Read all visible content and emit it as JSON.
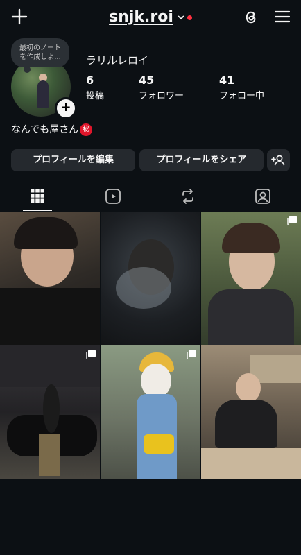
{
  "header": {
    "username": "snjk.roi"
  },
  "note": {
    "text_line1": "最初のノート",
    "text_line2": "を作成しよ..."
  },
  "profile": {
    "display_name": "ラリルレロイ",
    "stats": [
      {
        "value": "6",
        "label": "投稿"
      },
      {
        "value": "45",
        "label": "フォロワー"
      },
      {
        "value": "41",
        "label": "フォロー中"
      }
    ],
    "bio": "なんでも屋さん",
    "bio_badge": "秘"
  },
  "buttons": {
    "edit_profile": "プロフィールを編集",
    "share_profile": "プロフィールをシェア"
  },
  "tabs": [
    "grid-icon",
    "reels-icon",
    "reposts-icon",
    "tagged-icon"
  ],
  "grid": [
    {
      "name": "post-1",
      "multi": false,
      "bg": "#3a3530"
    },
    {
      "name": "post-2",
      "multi": false,
      "bg": "#1e2226"
    },
    {
      "name": "post-3",
      "multi": true,
      "bg": "#4f5a3e"
    },
    {
      "name": "post-4",
      "multi": true,
      "bg": "#2c2a2c"
    },
    {
      "name": "post-5",
      "multi": true,
      "bg": "#6f7a66"
    },
    {
      "name": "post-6",
      "multi": false,
      "bg": "#8a7d6c"
    }
  ],
  "colors": {
    "background": "#0c1014",
    "button": "#25292e",
    "accent_red": "#ff3040"
  }
}
